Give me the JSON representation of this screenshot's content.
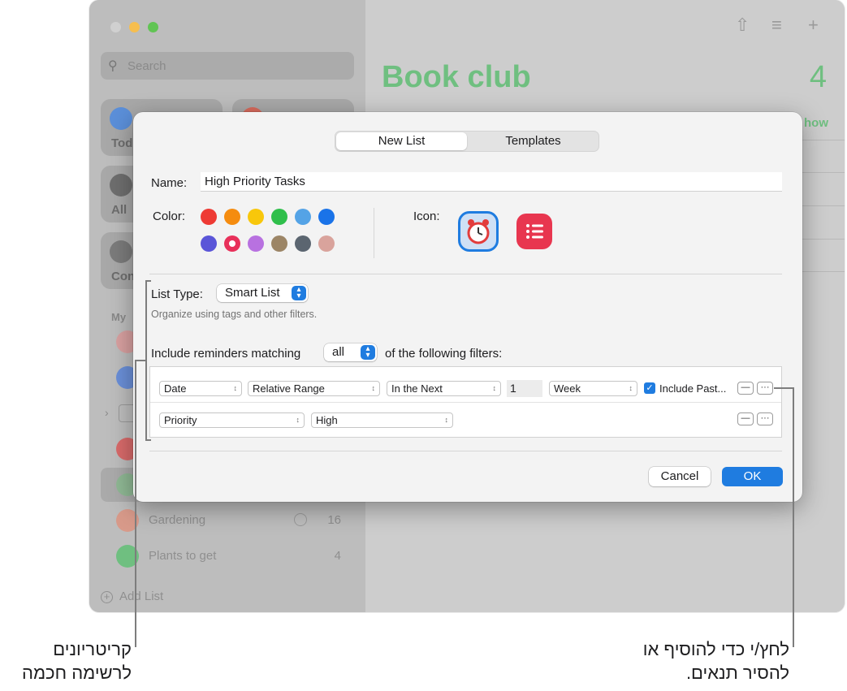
{
  "sidebar": {
    "search_placeholder": "Search",
    "tiles": [
      {
        "label": "Tod",
        "color": "#5b8fd9"
      },
      {
        "label": "",
        "color": "#d86a5c"
      },
      {
        "label": "All",
        "color": "#6e6e6e"
      },
      {
        "label": "Con",
        "color": "#7b7b7b"
      }
    ],
    "section_label": "My",
    "lists": [
      {
        "label": "",
        "count": "",
        "color": "#d88080"
      },
      {
        "label": "",
        "count": "",
        "color": "#6a8fd8"
      },
      {
        "label": "",
        "count": "",
        "color": "#d86a6a"
      },
      {
        "label": "",
        "count": "",
        "color": "#9a9a9a"
      },
      {
        "label": "Gardening",
        "count": "16",
        "color": "#d89a8a"
      },
      {
        "label": "Plants to get",
        "count": "4",
        "color": "#6fbf80"
      }
    ],
    "add_list_label": "Add List"
  },
  "main": {
    "title": "Book club",
    "count": "4",
    "show_label": "how",
    "toolbar_icons": [
      "share-icon",
      "list-format-icon",
      "plus-icon"
    ]
  },
  "dialog": {
    "tabs": [
      {
        "label": "New List",
        "active": true
      },
      {
        "label": "Templates",
        "active": false
      }
    ],
    "name_label": "Name:",
    "name_value": "High Priority Tasks",
    "color_label": "Color:",
    "colors": [
      "#ee3a34",
      "#f58c0f",
      "#f8c70b",
      "#2fbf4b",
      "#54a3e6",
      "#1a73e8",
      "#5a55d8",
      "#e8305a",
      "#b871e0",
      "#9c8566",
      "#5b6570",
      "#d9a39c"
    ],
    "selected_color_index": 7,
    "icon_label": "Icon:",
    "icons": [
      "alarm-clock-icon",
      "list-icon"
    ],
    "list_type_label": "List Type:",
    "list_type_value": "Smart List",
    "list_type_hint": "Organize using tags and other filters.",
    "include_label": "Include reminders matching",
    "match_value": "all",
    "filters_label": "of the following filters:",
    "filter_rows": [
      {
        "field": "Date",
        "operator": "Relative Range",
        "qualifier": "In the Next",
        "number": "1",
        "unit": "Week",
        "checkbox_label": "Include Past..."
      },
      {
        "field": "Priority",
        "operator": "High"
      }
    ],
    "remove_glyph": "—",
    "more_glyph": "···",
    "cancel_label": "Cancel",
    "ok_label": "OK"
  },
  "callouts": {
    "left": [
      "קריטריונים",
      "לרשימה חכמה"
    ],
    "right": [
      "לחץ/י כדי להוסיף או",
      "להסיר תנאים."
    ]
  }
}
